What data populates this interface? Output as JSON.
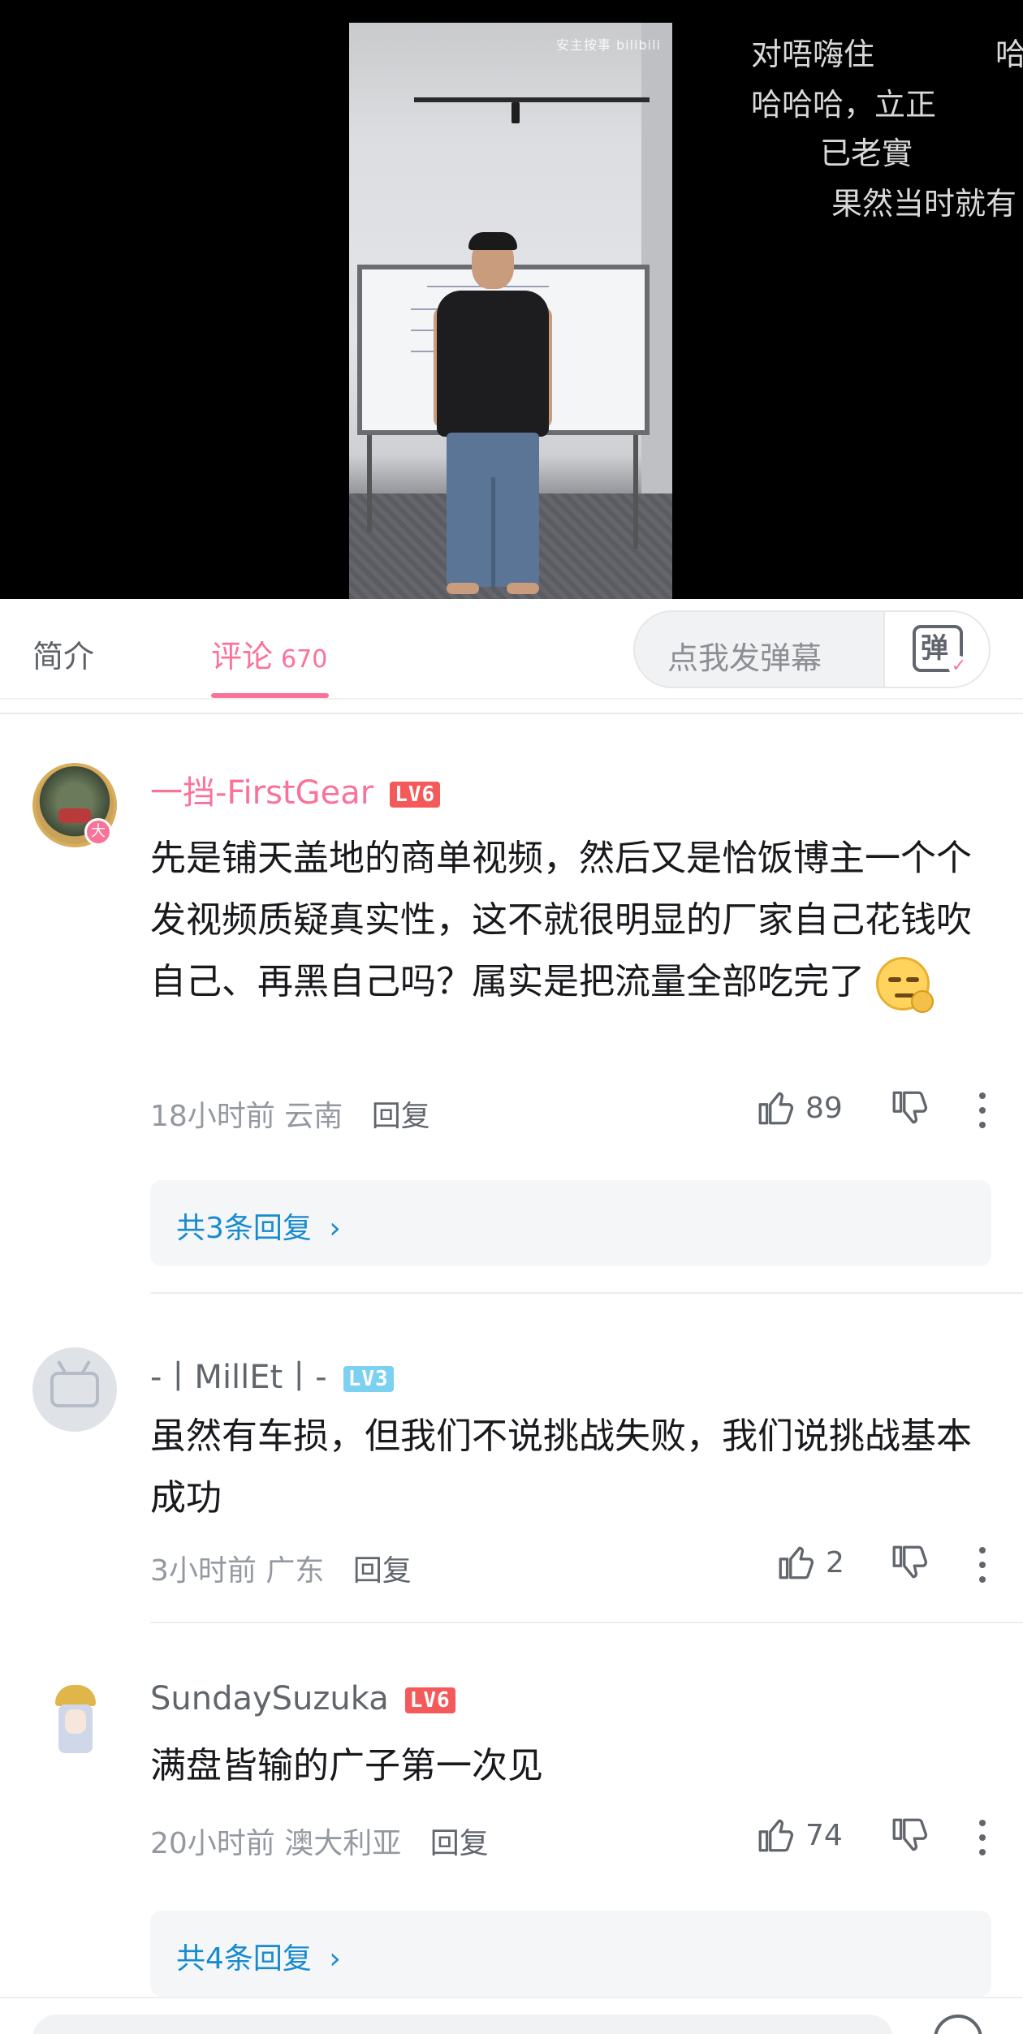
{
  "player": {
    "watermark": "安主按事 bilibili",
    "danmaku": [
      "对唔嗨住",
      "哈",
      "哈哈哈，立正",
      "已老實",
      "果然当时就有"
    ]
  },
  "tabs": {
    "intro": "简介",
    "comments": "评论",
    "comments_count": "670",
    "danmaku_placeholder": "点我发弹幕",
    "danmaku_icon_char": "弹"
  },
  "comments": [
    {
      "username": "一挡-FirstGear",
      "username_color": "#fb7299",
      "level": "LV6",
      "text": "先是铺天盖地的商单视频，然后又是恰饭博主一个个发视频质疑真实性，这不就很明显的厂家自己花钱吹自己、再黑自己吗？属实是把流量全部吃完了",
      "time": "18小时前",
      "location": "云南",
      "reply_label": "回复",
      "likes": "89",
      "avatar_badge": "大",
      "replies_link": "共3条回复"
    },
    {
      "username": "-丨MillEt丨-",
      "username_color": "#61666d",
      "level": "LV3",
      "text": "虽然有车损，但我们不说挑战失败，我们说挑战基本成功",
      "time": "3小时前",
      "location": "广东",
      "reply_label": "回复",
      "likes": "2"
    },
    {
      "username": "SundaySuzuka",
      "username_color": "#61666d",
      "level": "LV6",
      "text": "满盘皆输的广子第一次见",
      "time": "20小时前",
      "location": "澳大利亚",
      "reply_label": "回复",
      "likes": "74",
      "replies_link": "共4条回复"
    }
  ],
  "colors": {
    "accent": "#fb7299",
    "link": "#178bcf",
    "lv6": "#f55a5a",
    "lv3": "#7cd0f2"
  }
}
